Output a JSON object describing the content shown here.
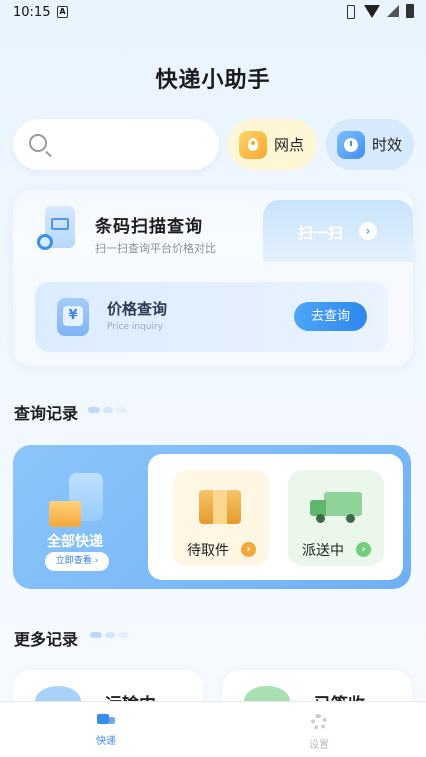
{
  "status_bar": {
    "time": "10:15",
    "app_badge": "A"
  },
  "header": {
    "title": "快递小助手"
  },
  "search": {
    "placeholder": "",
    "value": ""
  },
  "quick": [
    {
      "label": "网点",
      "icon": "location-pin-icon",
      "color": "#f6a82e"
    },
    {
      "label": "时效",
      "icon": "clock-icon",
      "color": "#3f8ef0"
    }
  ],
  "barcode": {
    "title": "条码扫描查询",
    "subtitle": "扫一扫查询平台价格对比",
    "scan_label": "扫一扫",
    "scan_chevron": "›"
  },
  "price_query": {
    "title": "价格查询",
    "subtitle": "Price inquiry",
    "icon_glyph": "¥",
    "button": "去查询"
  },
  "records": {
    "section_title": "查询记录",
    "all_label": "全部快递",
    "view_button": "立即查看 ›",
    "tiles": [
      {
        "label": "待取件",
        "arrow": "›"
      },
      {
        "label": "派送中",
        "arrow": "›"
      }
    ]
  },
  "more": {
    "section_title": "更多记录",
    "cards": [
      {
        "label": "运输中"
      },
      {
        "label": "已签收"
      }
    ]
  },
  "tabbar": {
    "tabs": [
      {
        "label": "快递",
        "icon": "truck-icon",
        "active": true
      },
      {
        "label": "设置",
        "icon": "gear-icon",
        "active": false
      }
    ]
  },
  "colors": {
    "accent": "#3a8cf0",
    "pickup": "#f4a83c",
    "deliver": "#6fcf7a"
  }
}
